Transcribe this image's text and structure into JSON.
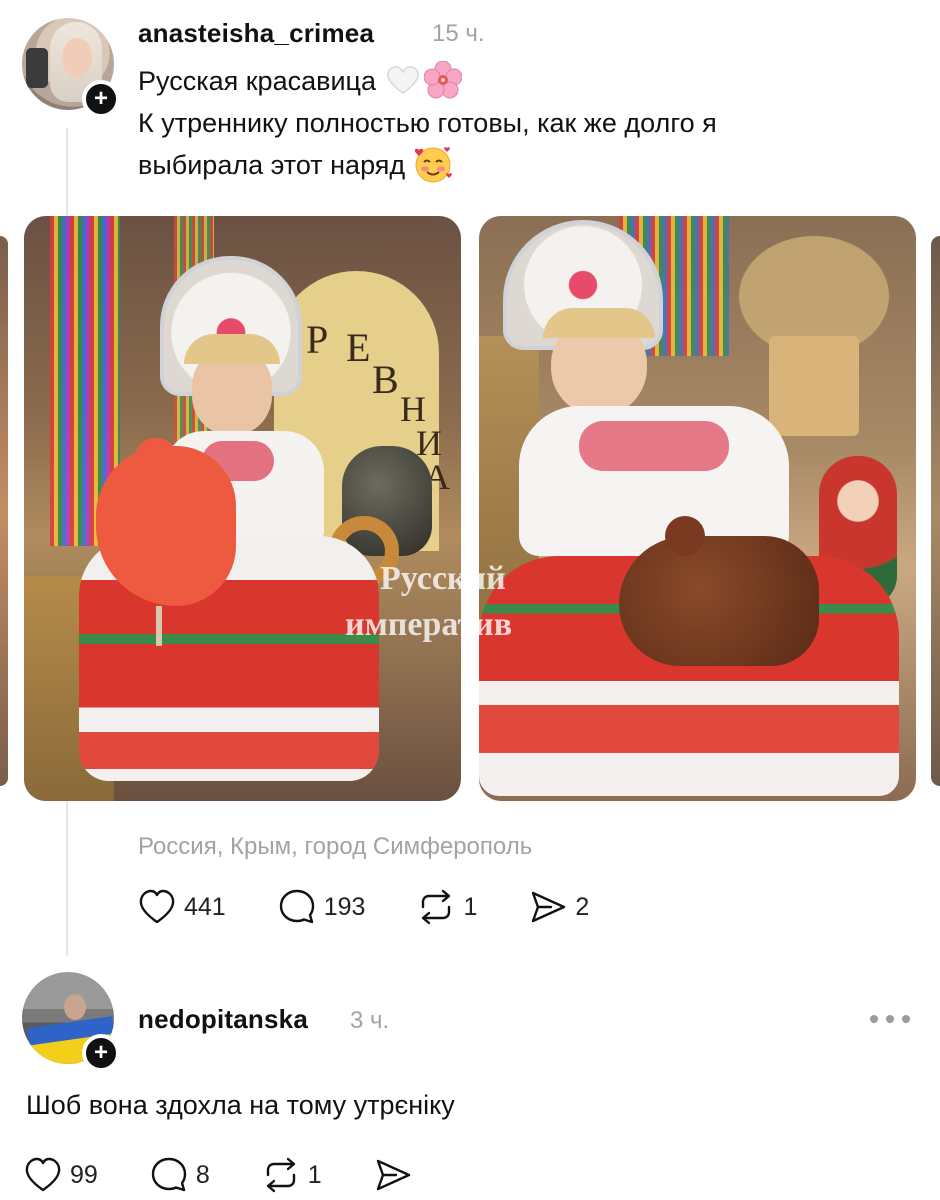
{
  "post": {
    "username": "anasteisha_crimea",
    "time": "15 ч.",
    "line1": "Русская красавица",
    "line2": "К утреннику полностью готовы, как же долго я",
    "line3": "выбирала этот наряд",
    "emoji": [
      "white-heart-icon",
      "cherry-blossom-icon",
      "smiling-face-with-hearts-icon"
    ],
    "photos": [
      {
        "letters": [
          "Р",
          "Е",
          "В",
          "Н",
          "И",
          "А"
        ]
      },
      {
        "watermark_line1": "Русский",
        "watermark_line2": "императив"
      }
    ],
    "location": "Россия, Крым, город Симферополь",
    "actions": {
      "likes": "441",
      "comments": "193",
      "reposts": "1",
      "shares": "2"
    }
  },
  "reply": {
    "username": "nedopitanska",
    "time": "3 ч.",
    "text": "Шоб вона здохла на тому утрєніку",
    "actions": {
      "likes": "99",
      "comments": "8",
      "reposts": "1"
    }
  },
  "colors": {
    "text": "#111111",
    "muted": "#a3a3a3",
    "badge": "#111111"
  }
}
